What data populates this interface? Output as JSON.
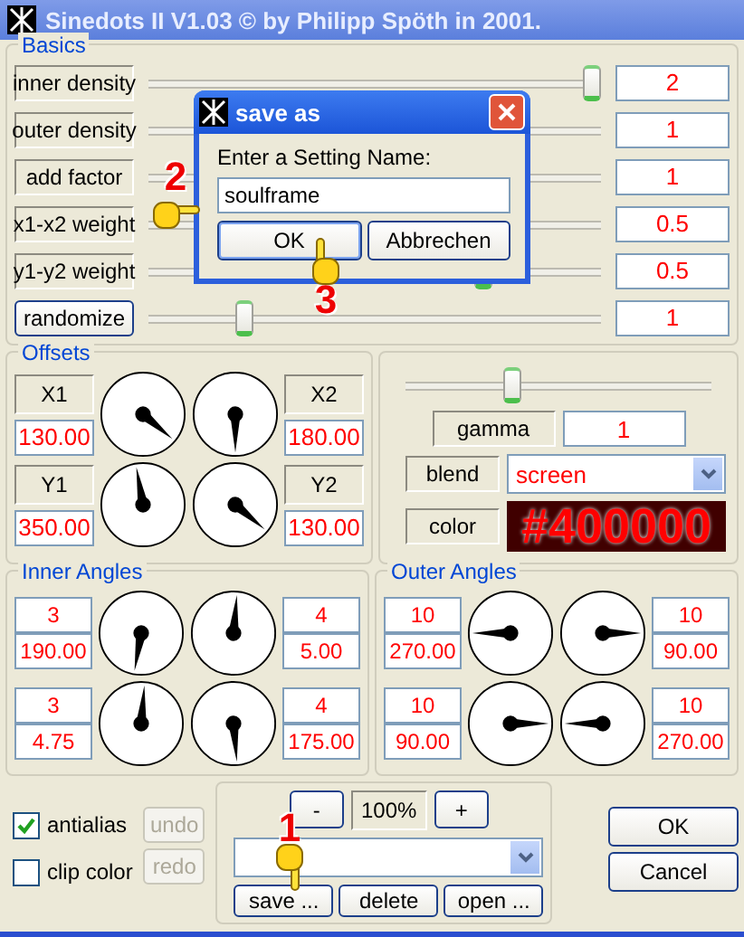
{
  "window": {
    "title": "Sinedots II V1.03 © by Philipp Spöth in 2001."
  },
  "basics": {
    "title": "Basics",
    "rows": [
      {
        "kind": "label",
        "label": "inner density",
        "level": 0.98,
        "value": "2"
      },
      {
        "kind": "label",
        "label": "outer density",
        "value": "1"
      },
      {
        "kind": "label",
        "label": "add factor",
        "value": "1"
      },
      {
        "kind": "label",
        "label": "x1-x2 weight",
        "value": "0.5"
      },
      {
        "kind": "label",
        "label": "y1-y2 weight",
        "level": 0.74,
        "value": "0.5"
      },
      {
        "kind": "button",
        "label": "randomize",
        "level": 0.21,
        "value": "1"
      }
    ]
  },
  "offsets": {
    "title": "Offsets",
    "rows": [
      {
        "left": {
          "label": "X1",
          "value": "130.00"
        },
        "right": {
          "label": "X2",
          "value": "180.00"
        }
      },
      {
        "left": {
          "label": "Y1",
          "value": "350.00"
        },
        "right": {
          "label": "Y2",
          "value": "130.00"
        }
      }
    ]
  },
  "render": {
    "gamma": {
      "label": "gamma",
      "level": 0.35,
      "value": "1"
    },
    "blend": {
      "label": "blend",
      "value": "screen"
    },
    "color": {
      "label": "color",
      "value": "#400000"
    }
  },
  "inner_angles": {
    "title": "Inner Angles",
    "rows": [
      {
        "left": {
          "count": "3",
          "angle": "190.00"
        },
        "right": {
          "count": "4",
          "angle": "5.00"
        }
      },
      {
        "left": {
          "count": "3",
          "angle": "4.75"
        },
        "right": {
          "count": "4",
          "angle": "175.00"
        }
      }
    ]
  },
  "outer_angles": {
    "title": "Outer Angles",
    "rows": [
      {
        "left": {
          "count": "10",
          "angle": "270.00"
        },
        "right": {
          "count": "10",
          "angle": "90.00"
        }
      },
      {
        "left": {
          "count": "10",
          "angle": "90.00"
        },
        "right": {
          "count": "10",
          "angle": "270.00"
        }
      }
    ]
  },
  "options": [
    {
      "label": "antialias",
      "checked": true
    },
    {
      "label": "clip color",
      "checked": false
    }
  ],
  "history": [
    {
      "label": "undo",
      "disabled": true
    },
    {
      "label": "redo",
      "disabled": true
    }
  ],
  "zoom": {
    "minus": "-",
    "value": "100%",
    "plus": "+"
  },
  "presets": {
    "buttons": [
      "save ...",
      "delete",
      "open ..."
    ]
  },
  "buttons": [
    "OK",
    "Cancel"
  ],
  "dialog": {
    "title": "save as",
    "prompt": "Enter a Setting Name:",
    "value": "soulframe",
    "buttons": [
      {
        "label": "OK",
        "default": true
      },
      {
        "label": "Abbrechen",
        "default": false
      }
    ]
  },
  "annotations": [
    {
      "number": "1"
    },
    {
      "number": "2"
    },
    {
      "number": "3"
    }
  ]
}
